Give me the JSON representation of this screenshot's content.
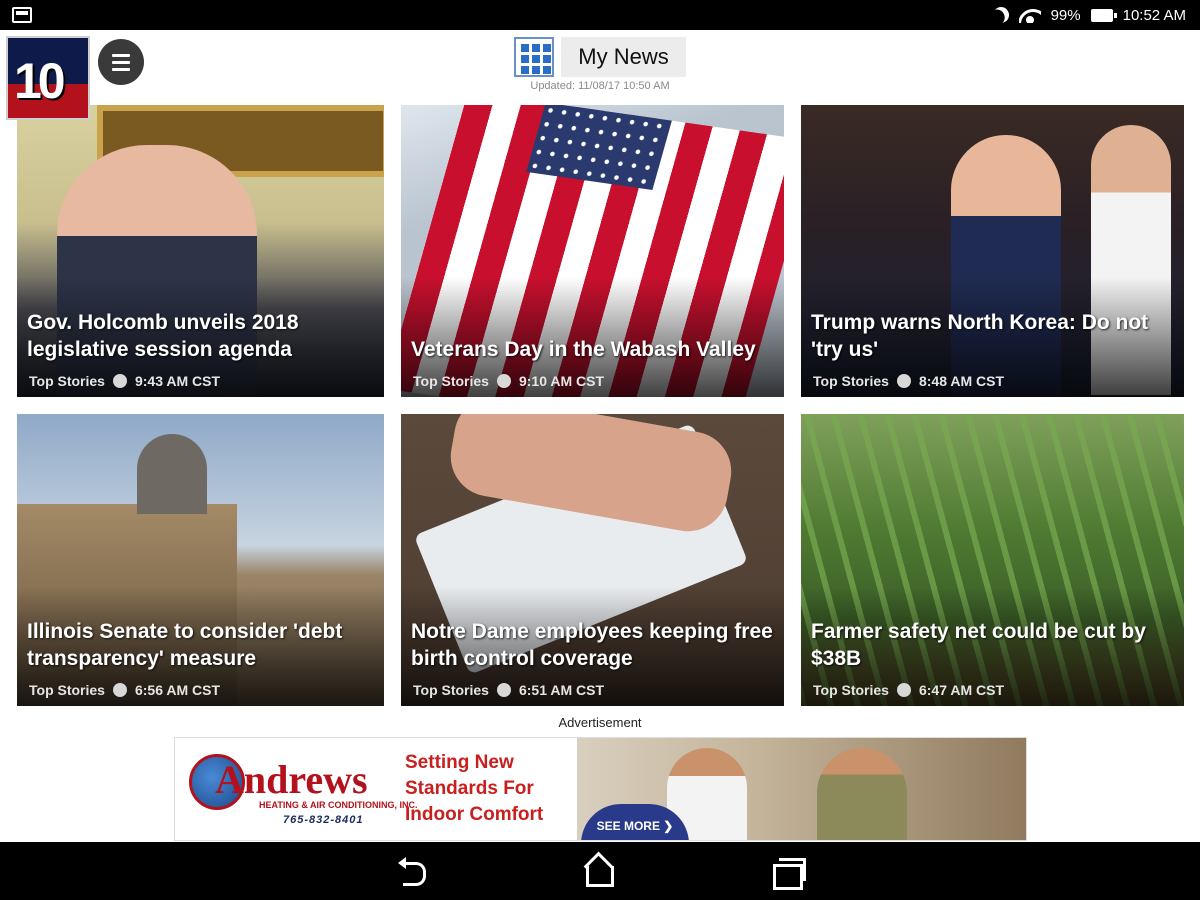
{
  "status_bar": {
    "battery": "99%",
    "time": "10:52 AM",
    "icons": [
      "screenshot-icon",
      "do-not-disturb-moon-icon",
      "wifi-icon",
      "battery-icon"
    ]
  },
  "header": {
    "logo_text": "10",
    "title": "My News",
    "updated": "Updated: 11/08/17 10:50 AM",
    "icons": [
      "menu-icon",
      "grid-view-icon"
    ]
  },
  "stories": [
    {
      "headline": "Gov. Holcomb unveils 2018 legislative session agenda",
      "category": "Top Stories",
      "time": "9:43 AM CST"
    },
    {
      "headline": "Veterans Day in the Wabash Valley",
      "category": "Top Stories",
      "time": "9:10 AM CST"
    },
    {
      "headline": "Trump warns North Korea: Do not 'try us'",
      "category": "Top Stories",
      "time": "8:48 AM CST"
    },
    {
      "headline": "Illinois Senate to consider 'debt transparency' measure",
      "category": "Top Stories",
      "time": "6:56 AM CST"
    },
    {
      "headline": "Notre Dame employees keeping free birth control coverage",
      "category": "Top Stories",
      "time": "6:51 AM CST"
    },
    {
      "headline": "Farmer safety net could be cut by $38B",
      "category": "Top Stories",
      "time": "6:47 AM CST"
    }
  ],
  "ad": {
    "label": "Advertisement",
    "brand": "Andrews",
    "brand_sub": "HEATING & AIR CONDITIONING, INC.",
    "phone": "765-832-8401",
    "tagline": "Setting New Standards For Indoor Comfort",
    "cta": "SEE MORE ❯"
  },
  "nav": {
    "icons": [
      "back-icon",
      "home-icon",
      "recent-apps-icon"
    ]
  },
  "colors": {
    "brand_red": "#b3111b",
    "brand_navy": "#0d1a4a",
    "grid_blue": "#2b6cc4"
  }
}
